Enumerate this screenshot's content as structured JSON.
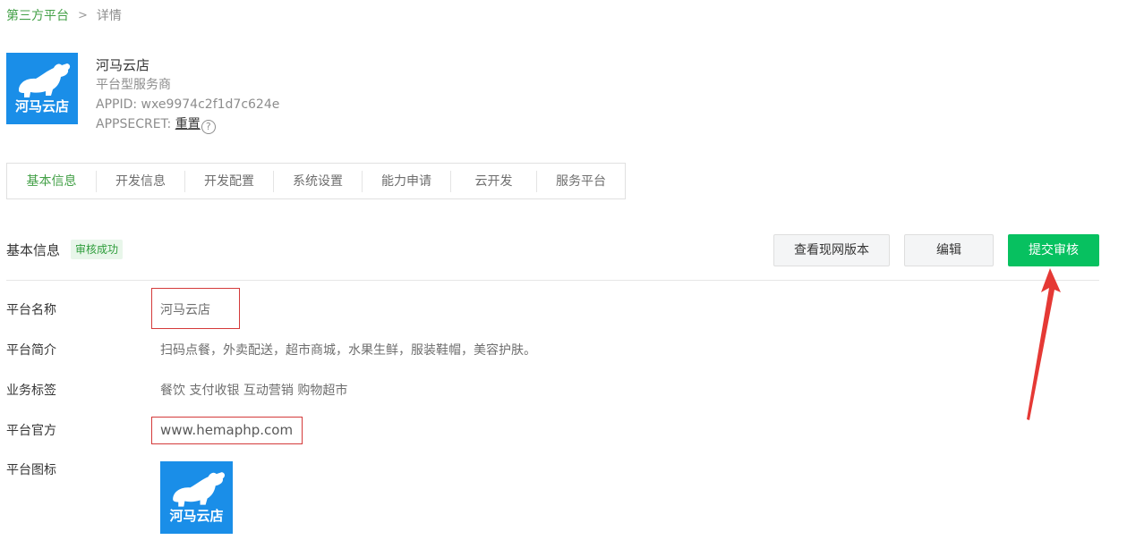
{
  "breadcrumb": {
    "parent": "第三方平台",
    "separator": ">",
    "current": "详情"
  },
  "account": {
    "logo_text": "河马云店",
    "name": "河马云店",
    "type": "平台型服务商",
    "appid": "APPID: wxe9974c2f1d7c624e",
    "appsecret_label": "APPSECRET:",
    "reset_label": "重置",
    "help_icon": "question-circle-icon"
  },
  "tabs": [
    {
      "label": "基本信息",
      "active": true
    },
    {
      "label": "开发信息",
      "active": false
    },
    {
      "label": "开发配置",
      "active": false
    },
    {
      "label": "系统设置",
      "active": false
    },
    {
      "label": "能力申请",
      "active": false
    },
    {
      "label": "云开发",
      "active": false
    },
    {
      "label": "服务平台",
      "active": false
    }
  ],
  "section": {
    "title": "基本信息",
    "status": "审核成功",
    "buttons": {
      "view_current": "查看现网版本",
      "edit": "编辑",
      "submit": "提交审核"
    }
  },
  "fields": [
    {
      "label": "平台名称",
      "value": "河马云店"
    },
    {
      "label": "平台简介",
      "value": "扫码点餐，外卖配送，超市商城，水果生鲜，服装鞋帽，美容护肤。"
    },
    {
      "label": "业务标签",
      "value": "餐饮 支付收银 互动营销 购物超市"
    },
    {
      "label": "平台官方",
      "value": "www.hemaphp.com"
    },
    {
      "label": "平台图标",
      "value": ""
    }
  ],
  "colors": {
    "accent_green": "#43a047",
    "primary_button": "#07c160",
    "logo_blue": "#1a8ee8",
    "annotation_red": "#e53935"
  }
}
